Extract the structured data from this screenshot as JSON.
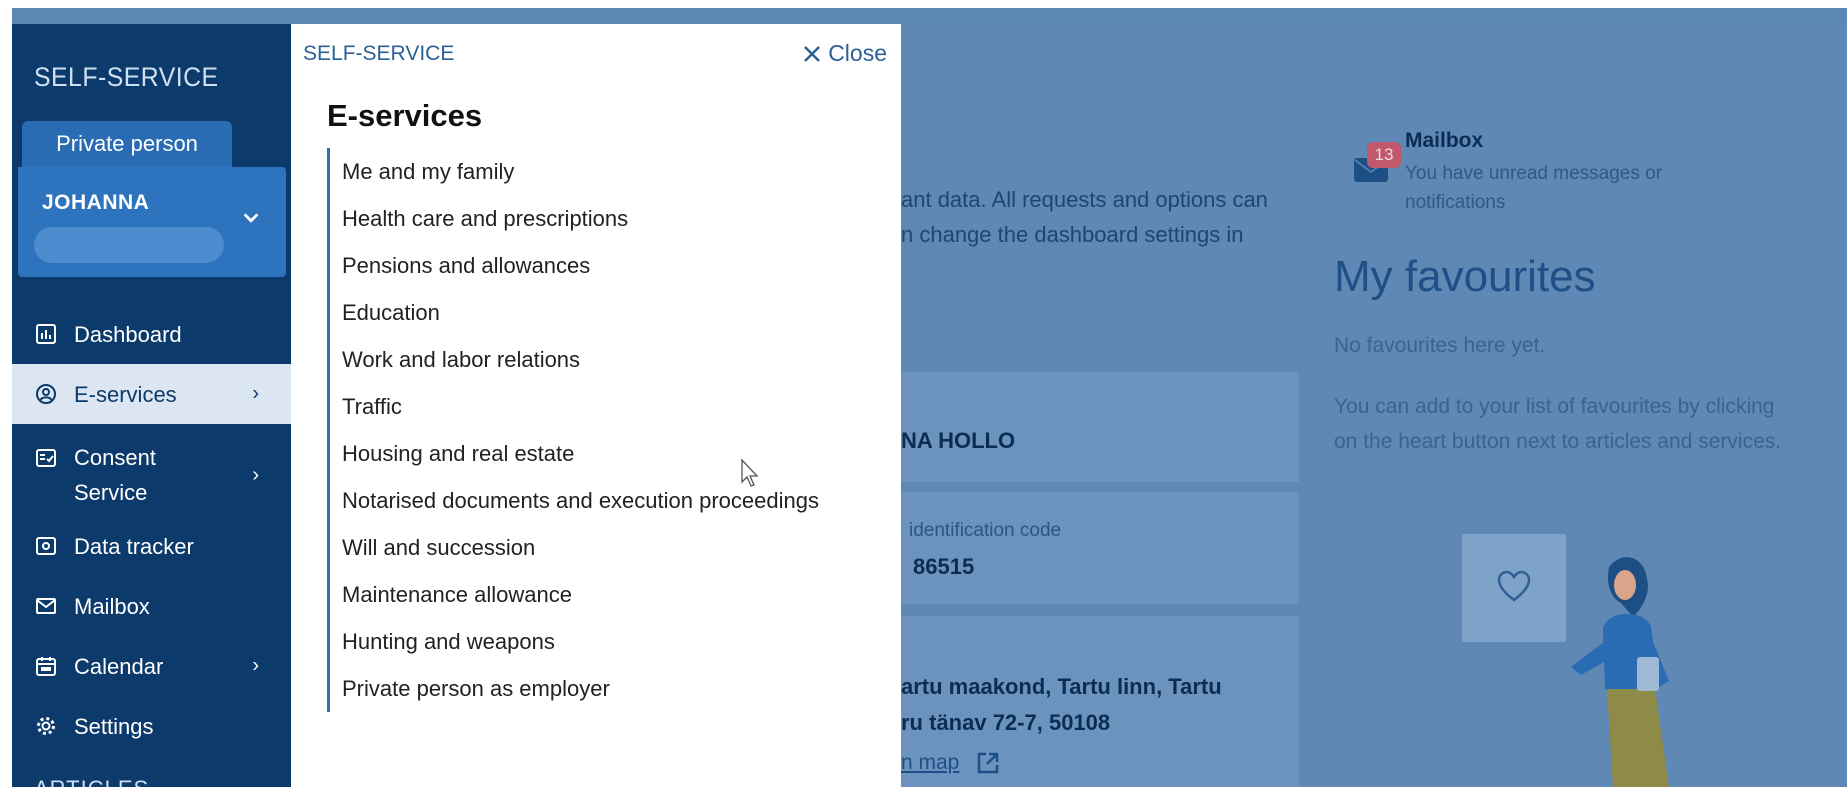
{
  "sidebar": {
    "brand": "SELF-SERVICE",
    "role": "Private person",
    "user_name": "JOHANNA",
    "items": [
      {
        "label": "Dashboard",
        "icon": "dashboard-icon",
        "has_arrow": false
      },
      {
        "label": "E-services",
        "icon": "user-circle-icon",
        "has_arrow": true,
        "active": true
      },
      {
        "label": "Consent\nService",
        "icon": "consent-icon",
        "has_arrow": true
      },
      {
        "label": "Data tracker",
        "icon": "eye-icon",
        "has_arrow": false
      },
      {
        "label": "Mailbox",
        "icon": "envelope-icon",
        "has_arrow": false
      },
      {
        "label": "Calendar",
        "icon": "calendar-icon",
        "has_arrow": true
      },
      {
        "label": "Settings",
        "icon": "gear-icon",
        "has_arrow": false
      }
    ],
    "footer": "ARTICLES"
  },
  "flyout": {
    "brand": "SELF-SERVICE",
    "close_label": "Close",
    "title": "E-services",
    "items": [
      "Me and my family",
      "Health care and prescriptions",
      "Pensions and allowances",
      "Education",
      "Work and labor relations",
      "Traffic",
      "Housing and real estate",
      "Notarised documents and execution proceedings",
      "Will and succession",
      "Maintenance allowance",
      "Hunting and weapons",
      "Private person as employer"
    ]
  },
  "background": {
    "intro_line1": "ant data. All requests and options can",
    "intro_line2": "n change the dashboard settings in",
    "person_name": "NA HOLLO",
    "id_label": "identification code",
    "id_value": "86515",
    "address_line1": "artu maakond, Tartu linn, Tartu",
    "address_line2": "ru tänav 72-7, 50108",
    "map_link": "n map",
    "mailbox_title": "Mailbox",
    "mailbox_badge": "13",
    "mailbox_desc": "You have unread messages or notifications",
    "favourites_title": "My favourites",
    "favourites_empty": "No favourites here yet.",
    "favourites_help": "You can add to your list of favourites by clicking on the heart button next to articles and services."
  },
  "colors": {
    "sidebar_bg": "#0b3a6b",
    "accent": "#2f6fb2",
    "overlay": "#5f88b4"
  }
}
